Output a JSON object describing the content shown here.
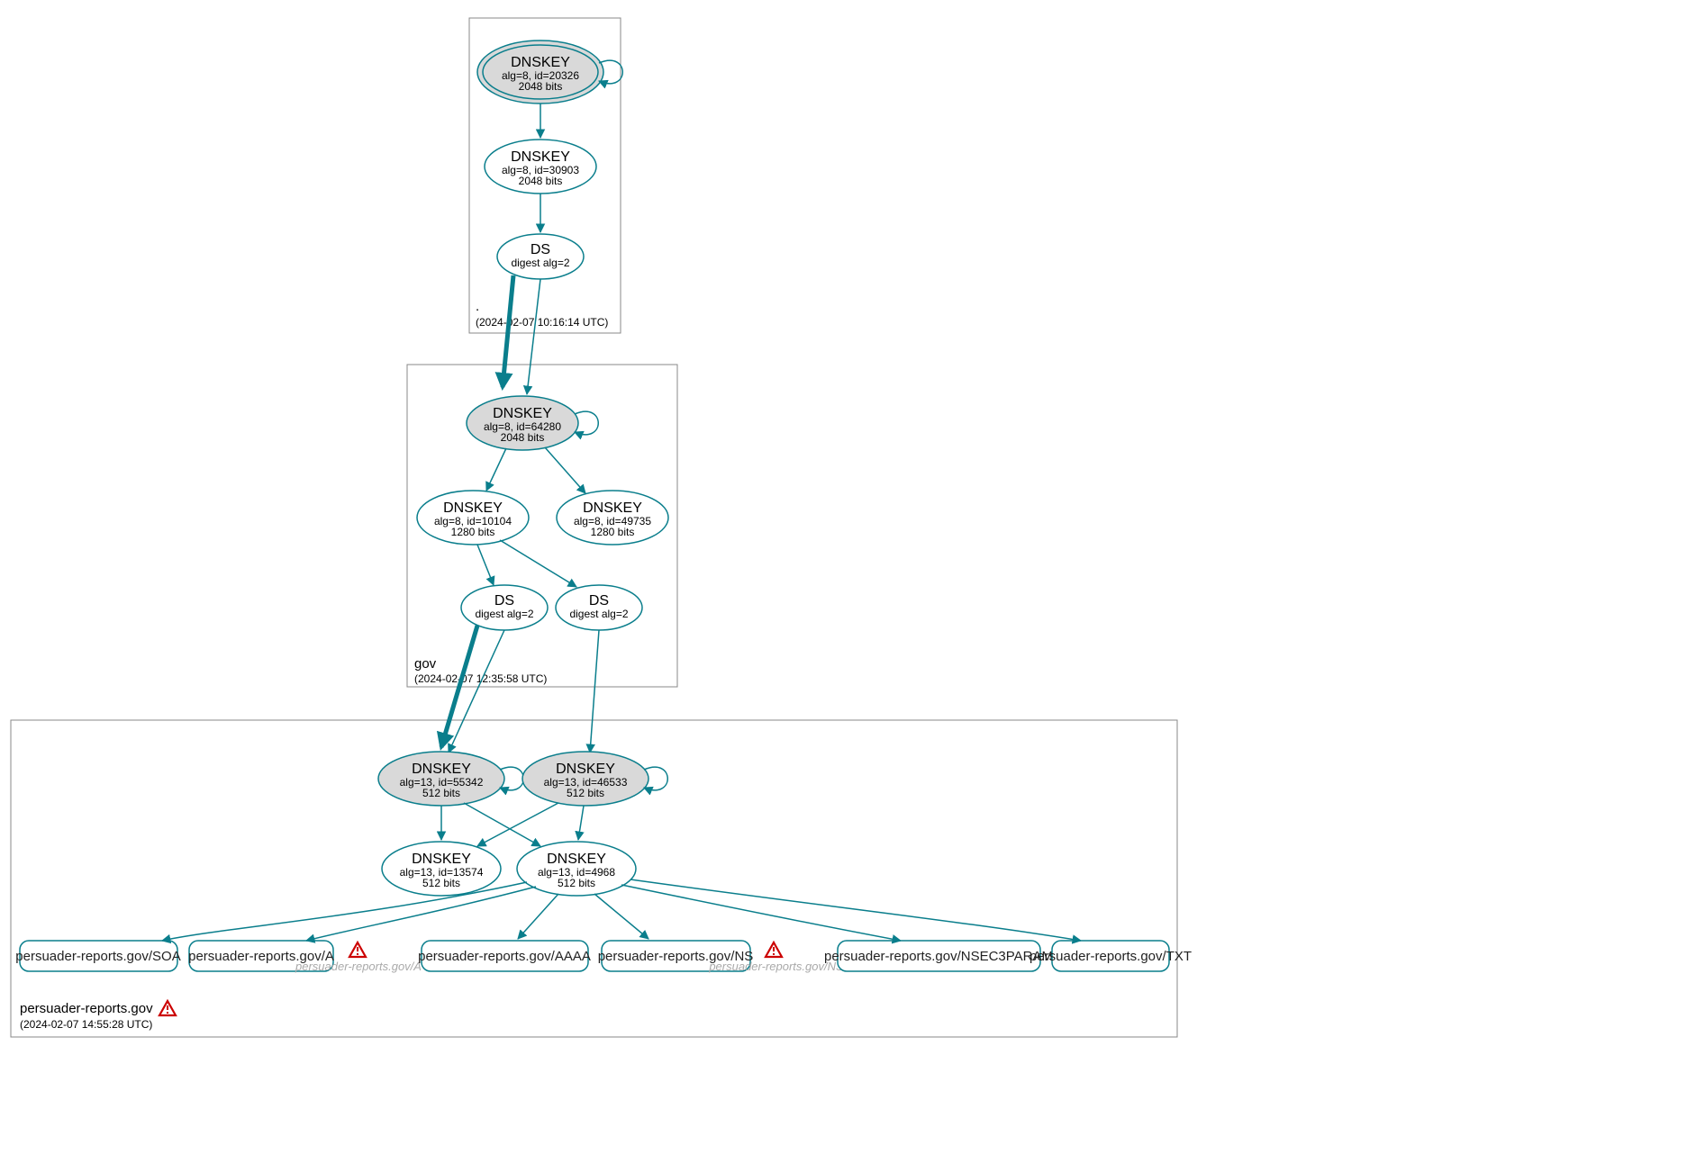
{
  "zones": {
    "root": {
      "label": ".",
      "timestamp": "(2024-02-07 10:16:14 UTC)"
    },
    "gov": {
      "label": "gov",
      "timestamp": "(2024-02-07 12:35:58 UTC)"
    },
    "zone3": {
      "label": "persuader-reports.gov",
      "timestamp": "(2024-02-07 14:55:28 UTC)"
    }
  },
  "nodes": {
    "root_ksk": {
      "title": "DNSKEY",
      "line1": "alg=8, id=20326",
      "line2": "2048 bits"
    },
    "root_zsk": {
      "title": "DNSKEY",
      "line1": "alg=8, id=30903",
      "line2": "2048 bits"
    },
    "root_ds": {
      "title": "DS",
      "line1": "digest alg=2"
    },
    "gov_ksk": {
      "title": "DNSKEY",
      "line1": "alg=8, id=64280",
      "line2": "2048 bits"
    },
    "gov_zsk1": {
      "title": "DNSKEY",
      "line1": "alg=8, id=10104",
      "line2": "1280 bits"
    },
    "gov_zsk2": {
      "title": "DNSKEY",
      "line1": "alg=8, id=49735",
      "line2": "1280 bits"
    },
    "gov_ds1": {
      "title": "DS",
      "line1": "digest alg=2"
    },
    "gov_ds2": {
      "title": "DS",
      "line1": "digest alg=2"
    },
    "z3_ksk1": {
      "title": "DNSKEY",
      "line1": "alg=13, id=55342",
      "line2": "512 bits"
    },
    "z3_ksk2": {
      "title": "DNSKEY",
      "line1": "alg=13, id=46533",
      "line2": "512 bits"
    },
    "z3_zsk1": {
      "title": "DNSKEY",
      "line1": "alg=13, id=13574",
      "line2": "512 bits"
    },
    "z3_zsk2": {
      "title": "DNSKEY",
      "line1": "alg=13, id=4968",
      "line2": "512 bits"
    }
  },
  "rr": {
    "soa": "persuader-reports.gov/SOA",
    "a": "persuader-reports.gov/A",
    "aaaa": "persuader-reports.gov/AAAA",
    "ns": "persuader-reports.gov/NS",
    "nsec": "persuader-reports.gov/NSEC3PARAM",
    "txt": "persuader-reports.gov/TXT"
  },
  "warnings": {
    "a": "persuader-reports.gov/A",
    "ns": "persuader-reports.gov/NS"
  }
}
